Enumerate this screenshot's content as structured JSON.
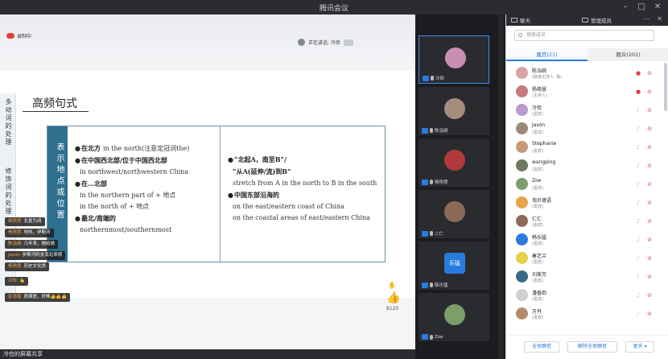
{
  "window": {
    "title": "腾讯会议"
  },
  "share": {
    "recording": "录制中",
    "speaking": "正在讲话: 冷俭",
    "slide": {
      "title": "高频句式",
      "sidebar": [
        "多动词的处理",
        "修饰词的处理"
      ],
      "label": "表示地点或位置",
      "left": [
        {
          "cn": "在北方",
          "en": "in the north(注意定冠词the)",
          "bullet": true
        },
        {
          "cn": "在中国西北部/位于中国西北部",
          "en": "",
          "bullet": true
        },
        {
          "cn": "",
          "en": "in northwest/northwestern China",
          "bullet": false
        },
        {
          "cn": "在…北部",
          "en": "",
          "bullet": true
        },
        {
          "cn": "",
          "en": "in the northern part of + 地点",
          "bullet": false
        },
        {
          "cn": "",
          "en": "in the north of + 地点",
          "bullet": false
        },
        {
          "cn": "最北/南端的",
          "en": "",
          "bullet": true
        },
        {
          "cn": "",
          "en": "northernmost/southernmost",
          "bullet": false
        }
      ],
      "right": [
        {
          "cn": "“北起A，南至B”/",
          "en": "",
          "bullet": true
        },
        {
          "cn": "“从A(延伸/流)到B”",
          "en": "",
          "bullet": false
        },
        {
          "cn": "",
          "en": "stretch from A in the north to B in the south",
          "bullet": false
        },
        {
          "cn": "中国东部沿海的",
          "en": "",
          "bullet": true
        },
        {
          "cn": "",
          "en": "on the east/eastern coast of China",
          "bullet": false
        },
        {
          "cn": "",
          "en": "on the coastal areas of east/eastern China",
          "bullet": false
        }
      ]
    },
    "likes": "8120",
    "chat": [
      {
        "name": "杨艳慧",
        "text": "北复为阔"
      },
      {
        "name": "杨艳慧",
        "text": "地热，伊斯河"
      },
      {
        "name": "陈泓婉",
        "text": "几年来，她给她"
      },
      {
        "name": "Jason",
        "text": "伊斯河的支流北来视"
      },
      {
        "name": "杨艳慧",
        "text": "历史文化类"
      },
      {
        "name": "冷俭",
        "text": "👆"
      },
      {
        "name": "张清尾",
        "text": "很满意，好棒👍👍👍"
      }
    ],
    "footer": "冷俭的屏幕共享"
  },
  "strip": {
    "tiles": [
      {
        "name": "冷俭",
        "active": true,
        "avatar_color": "#c98fb3",
        "avatar_text": ""
      },
      {
        "name": "陈泓婉",
        "active": false,
        "avatar_color": "#a58d7c",
        "avatar_text": ""
      },
      {
        "name": "杨艳慧",
        "active": false,
        "avatar_color": "#b13b3b",
        "avatar_text": ""
      },
      {
        "name": "二仁",
        "active": false,
        "avatar_color": "#8d6a55",
        "avatar_text": ""
      },
      {
        "name": "韩乐猛",
        "active": false,
        "avatar_color": "#2a7bde",
        "avatar_text": "乐猛"
      },
      {
        "name": "Zoe",
        "active": false,
        "avatar_color": "#7a9f6a",
        "avatar_text": ""
      }
    ]
  },
  "panel": {
    "tab_chat": "聊天",
    "tab_members": "管理成员",
    "search_placeholder": "搜索成员",
    "tab_guests": "嘉宾(21)",
    "tab_audience": "观众(201)",
    "members": [
      {
        "name": "陈泓婉",
        "role": "(联席主持人, 我)",
        "color": "#d8a5a5",
        "mic": "on"
      },
      {
        "name": "杨艳慧",
        "role": "(主持人)",
        "color": "#c97a7a",
        "mic": "on"
      },
      {
        "name": "冷俭",
        "role": "(嘉宾)",
        "color": "#b89acb",
        "mic": "gray"
      },
      {
        "name": "Jason",
        "role": "(嘉宾)",
        "color": "#9a8a7a",
        "mic": "off"
      },
      {
        "name": "Stephanie",
        "role": "(嘉宾)",
        "color": "#c79a7a",
        "mic": "off"
      },
      {
        "name": "wangping",
        "role": "(嘉宾)",
        "color": "#6a7a5a",
        "mic": "off"
      },
      {
        "name": "Zoe",
        "role": "(嘉宾)",
        "color": "#7a9f6a",
        "mic": "off"
      },
      {
        "name": "淘贝德语",
        "role": "(嘉宾)",
        "color": "#e8a44a",
        "mic": "off"
      },
      {
        "name": "仁仁",
        "role": "(嘉宾)",
        "color": "#8d6a55",
        "mic": "off"
      },
      {
        "name": "韩乐猛",
        "role": "(嘉宾)",
        "color": "#2a7bde",
        "mic": "off"
      },
      {
        "name": "秦艺兰",
        "role": "(嘉宾)",
        "color": "#e6d24a",
        "mic": "off"
      },
      {
        "name": "刘美芳",
        "role": "(嘉宾)",
        "color": "#3a6a8a",
        "mic": "off"
      },
      {
        "name": "潘香韵",
        "role": "(嘉宾)",
        "color": "#d0d0d0",
        "mic": "off"
      },
      {
        "name": "万丹",
        "role": "(嘉宾)",
        "color": "#b58a6a",
        "mic": "off"
      }
    ],
    "btn_mute_all": "全体静音",
    "btn_unmute_all": "解除全体静音",
    "btn_more": "更多 ▾"
  }
}
